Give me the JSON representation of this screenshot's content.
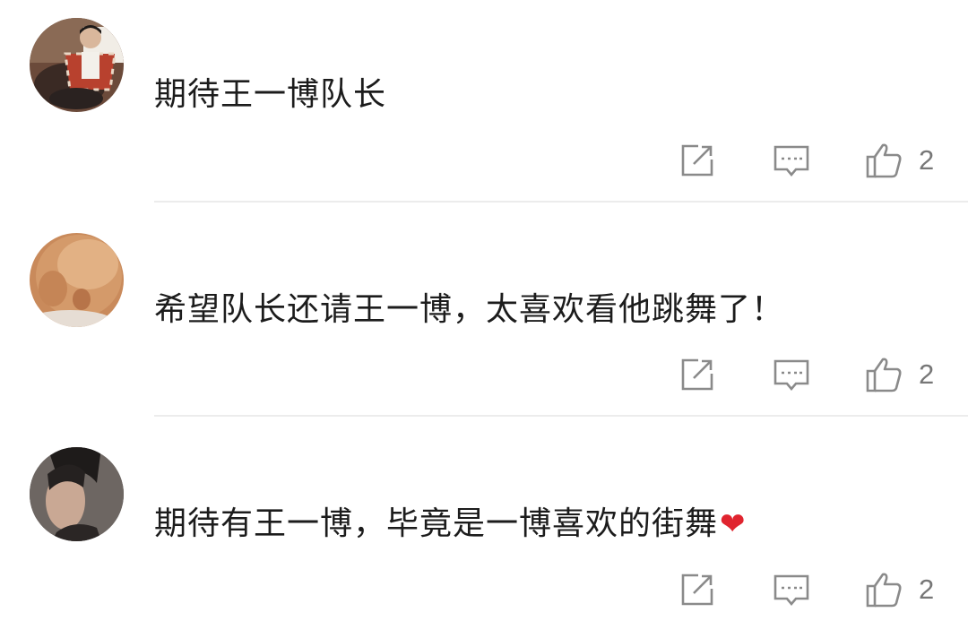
{
  "colors": {
    "text": "#1c1c1c",
    "icon": "#8a8a8a",
    "divider": "#ececec",
    "heart": "#e0242f"
  },
  "comments": [
    {
      "text": "期待王一博队长",
      "emoji": "",
      "avatar": "user-avatar-photo",
      "actions": {
        "share_icon": "share-icon",
        "reply_icon": "comment-icon",
        "like_icon": "thumbs-up-icon",
        "like_count": "2"
      }
    },
    {
      "text": "希望队长还请王一博，太喜欢看他跳舞了！",
      "emoji": "",
      "avatar": "user-avatar-baby-photo",
      "actions": {
        "share_icon": "share-icon",
        "reply_icon": "comment-icon",
        "like_icon": "thumbs-up-icon",
        "like_count": "2"
      }
    },
    {
      "text": "期待有王一博，毕竟是一博喜欢的街舞",
      "emoji": "❤",
      "avatar": "user-avatar-portrait",
      "actions": {
        "share_icon": "share-icon",
        "reply_icon": "comment-icon",
        "like_icon": "thumbs-up-icon",
        "like_count": "2"
      }
    }
  ]
}
